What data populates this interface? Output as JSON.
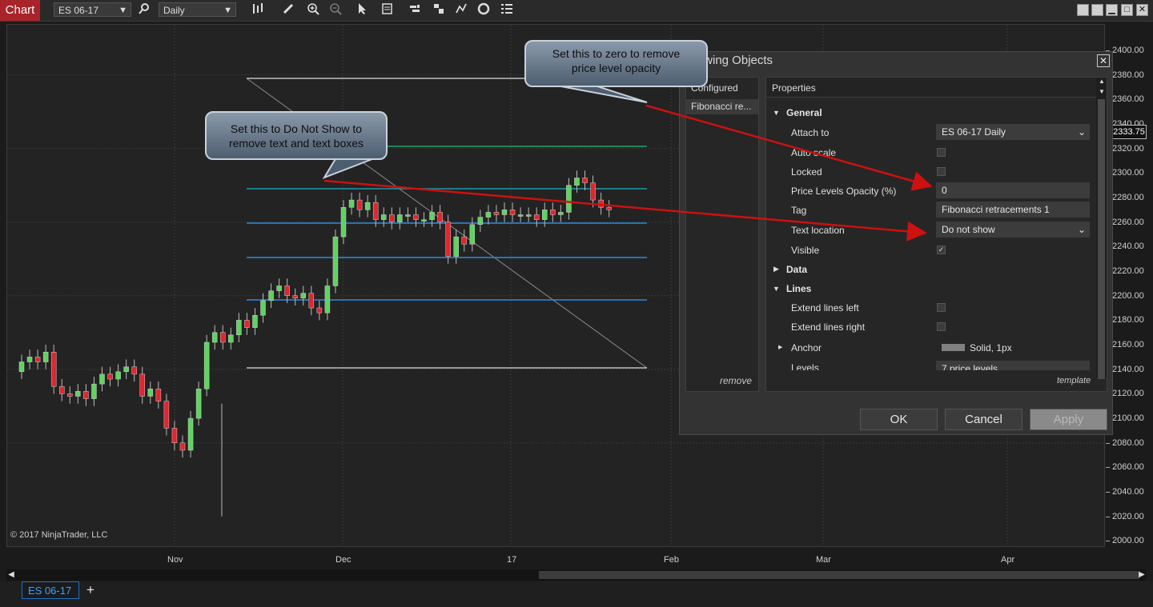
{
  "toolbar": {
    "chart_tab": "Chart",
    "instrument": "ES 06-17",
    "interval": "Daily"
  },
  "chart": {
    "last_price": "2333.75",
    "copyright": "© 2017 NinjaTrader, LLC",
    "price_ticks": [
      "2400.00",
      "2380.00",
      "2360.00",
      "2340.00",
      "2320.00",
      "2300.00",
      "2280.00",
      "2260.00",
      "2240.00",
      "2220.00",
      "2200.00",
      "2180.00",
      "2160.00",
      "2140.00",
      "2120.00",
      "2100.00",
      "2080.00",
      "2060.00",
      "2040.00",
      "2020.00",
      "2000.00"
    ],
    "date_labels": [
      "Nov",
      "Dec",
      "17",
      "Feb",
      "Mar",
      "Apr"
    ],
    "colors": {
      "up": "#5fd35f",
      "down": "#e0262e",
      "fib_green": "#1fa36b",
      "fib_teal": "#1a9aa8",
      "fib_blue": "#2a8be0"
    }
  },
  "bottom_tabs": {
    "active": "ES 06-17",
    "add": "+"
  },
  "dialog": {
    "title": "Drawing Objects",
    "configured_header": "Configured",
    "configured_item": "Fibonacci re...",
    "remove": "remove",
    "properties_header": "Properties",
    "template": "template",
    "groups": {
      "general": "General",
      "data": "Data",
      "lines": "Lines"
    },
    "props": {
      "attach_to_label": "Attach to",
      "attach_to_value": "ES 06-17 Daily",
      "auto_scale_label": "Auto scale",
      "locked_label": "Locked",
      "opacity_label": "Price Levels Opacity (%)",
      "opacity_value": "0",
      "tag_label": "Tag",
      "tag_value": "Fibonacci retracements 1",
      "text_location_label": "Text location",
      "text_location_value": "Do not show",
      "visible_label": "Visible",
      "extend_left_label": "Extend lines left",
      "extend_right_label": "Extend lines right",
      "anchor_label": "Anchor",
      "anchor_value": "Solid, 1px",
      "levels_label": "Levels",
      "levels_value": "7 price levels"
    },
    "buttons": {
      "ok": "OK",
      "cancel": "Cancel",
      "apply": "Apply"
    }
  },
  "callouts": {
    "opacity_line1": "Set this to zero to remove",
    "opacity_line2": "price level opacity",
    "text_line1": "Set this to Do Not Show to",
    "text_line2": "remove text and text boxes"
  }
}
